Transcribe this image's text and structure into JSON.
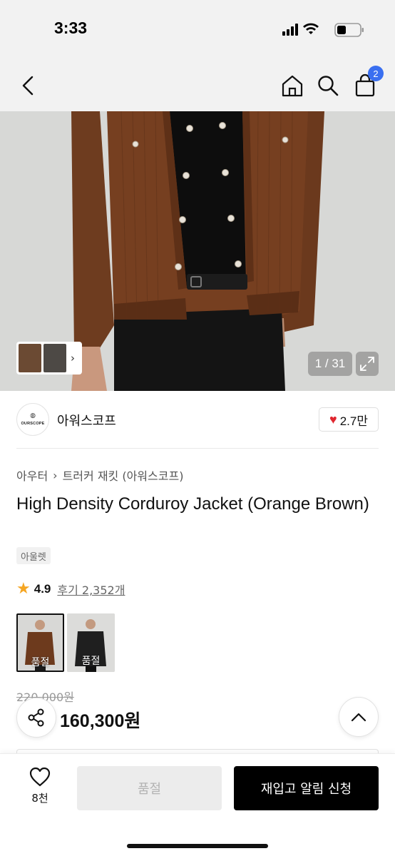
{
  "status_bar": {
    "time": "3:33"
  },
  "nav": {
    "cart_count": "2"
  },
  "gallery": {
    "counter": "1 / 31",
    "thumb_arrow": "›"
  },
  "brand": {
    "logo_text": "OURSCOPE",
    "name": "아워스코프",
    "likes": "2.7만"
  },
  "breadcrumb": {
    "category": "아우터",
    "separator": "›",
    "subcategory": "트러커 재킷 (아워스코프)"
  },
  "product": {
    "title": "High Density Corduroy Jacket (Orange Brown)",
    "tag": "아울렛",
    "rating": "4.9",
    "reviews": "후기 2,352개",
    "original_price": "220,000원",
    "sale_price": "160,300원"
  },
  "variants": [
    {
      "color": "Orange Brown",
      "status": "품절",
      "selected": true
    },
    {
      "color": "Black",
      "status": "품절",
      "selected": false
    }
  ],
  "bottom_bar": {
    "wish_count": "8천",
    "soldout_label": "품절",
    "restock_label": "재입고 알림 신청"
  },
  "colors": {
    "accent_badge": "#3a6ff0",
    "heart": "#e0262f",
    "star": "#f5a623",
    "jacket": "#6b3a1f"
  }
}
